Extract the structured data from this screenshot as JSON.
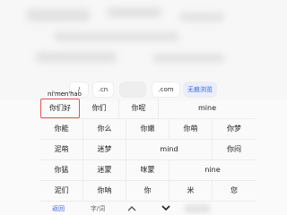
{
  "quick_bar": {
    "slash": "/",
    "cn": ".cn",
    "com": ".com",
    "private_browsing": "无痕浏览"
  },
  "composition": {
    "pinyin": "ni'men'hao"
  },
  "candidates": [
    [
      "你们好",
      "你们",
      "你呢",
      "mine"
    ],
    [
      "你能",
      "你么",
      "你嫩",
      "你萌",
      "你梦"
    ],
    [
      "泥萌",
      "迷梦",
      "mind",
      "你闷"
    ],
    [
      "你猛",
      "迷蒙",
      "咪蒙",
      "nine"
    ],
    [
      "泥们",
      "你呐",
      "你",
      "米",
      "您"
    ]
  ],
  "bottom_bar": {
    "back": "返回",
    "mode": "字/词"
  },
  "colors": {
    "accent": "#3d63d8",
    "selected_border": "#e05555"
  }
}
